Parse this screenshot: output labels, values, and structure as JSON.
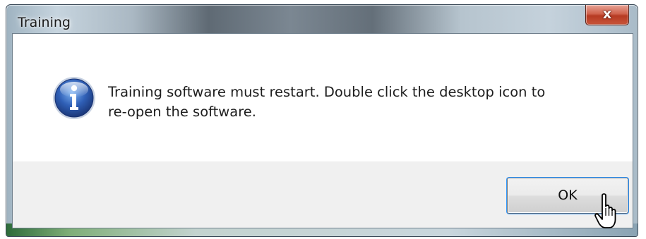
{
  "window": {
    "title": "Training",
    "close_icon": "close-icon",
    "close_glyph": "x"
  },
  "dialog": {
    "icon": "info-icon",
    "message_line1": "Training software must restart.  Double click the desktop icon to",
    "message_line2": "re-open the software.",
    "ok_label": "OK"
  },
  "cursor": {
    "icon": "mouse-pointer-icon"
  },
  "colors": {
    "close_button": "#c8553b",
    "info_icon": "#2f5fb6",
    "focus_ring": "#3399ff"
  }
}
